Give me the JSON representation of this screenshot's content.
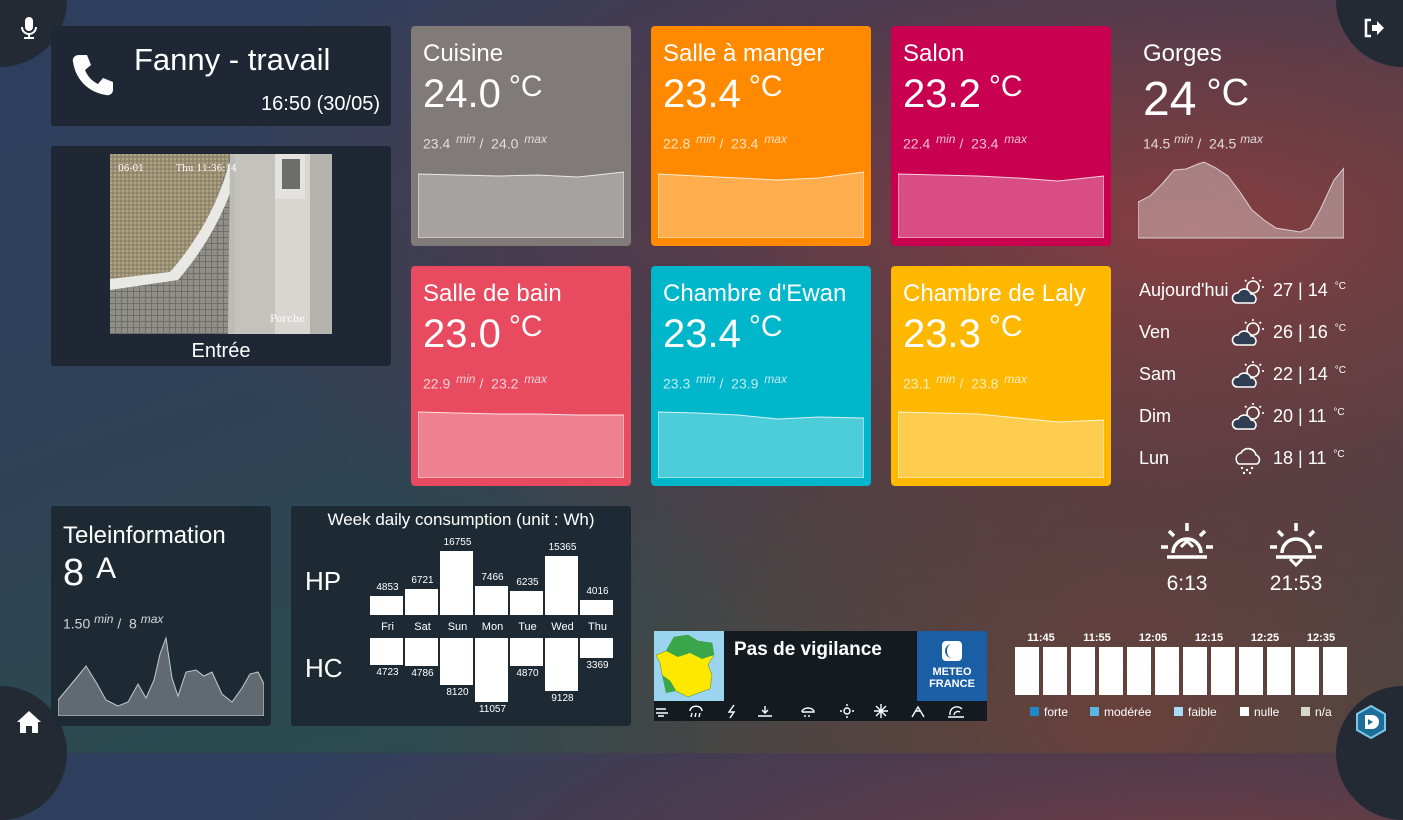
{
  "colors": {
    "cuisine": "#807a79",
    "salle_a_manger": "#ff8a00",
    "salon": "#c8004f",
    "salle_de_bain": "#e84a5f",
    "chambre_ewan": "#00b6cb",
    "chambre_laly": "#ffb800"
  },
  "corners": {
    "tl": "microphone-icon",
    "tr": "sign-out-icon",
    "bl": "home-icon",
    "br": "logo-icon"
  },
  "phone": {
    "name": "Fanny - travail",
    "time": "16:50 (30/05)"
  },
  "camera": {
    "label": "Entrée",
    "overlay_time": "Thu 11:36:14",
    "overlay_date": "06-01",
    "overlay_name": "Porche"
  },
  "rooms": [
    {
      "name": "Cuisine",
      "value": "24.0",
      "unit": "°C",
      "min": "23.4",
      "max": "24.0",
      "min_label": "min",
      "max_label": "max"
    },
    {
      "name": "Salle à manger",
      "value": "23.4",
      "unit": "°C",
      "min": "22.8",
      "max": "23.4",
      "min_label": "min",
      "max_label": "max"
    },
    {
      "name": "Salon",
      "value": "23.2",
      "unit": "°C",
      "min": "22.4",
      "max": "23.4",
      "min_label": "min",
      "max_label": "max"
    },
    {
      "name": "Salle de bain",
      "value": "23.0",
      "unit": "°C",
      "min": "22.9",
      "max": "23.2",
      "min_label": "min",
      "max_label": "max"
    },
    {
      "name": "Chambre d'Ewan",
      "value": "23.4",
      "unit": "°C",
      "min": "23.3",
      "max": "23.9",
      "min_label": "min",
      "max_label": "max"
    },
    {
      "name": "Chambre de Laly",
      "value": "23.3",
      "unit": "°C",
      "min": "23.1",
      "max": "23.8",
      "min_label": "min",
      "max_label": "max"
    }
  ],
  "outdoor": {
    "name": "Gorges",
    "value": "24",
    "unit": "°C",
    "min": "14.5",
    "max": "24.5",
    "min_label": "min",
    "max_label": "max"
  },
  "forecast": [
    {
      "day": "Aujourd'hui",
      "icon": "partly-cloudy-icon",
      "max": "27",
      "min": "14",
      "unit": "°C"
    },
    {
      "day": "Ven",
      "icon": "partly-cloudy-icon",
      "max": "26",
      "min": "16",
      "unit": "°C"
    },
    {
      "day": "Sam",
      "icon": "partly-cloudy-icon",
      "max": "22",
      "min": "14",
      "unit": "°C"
    },
    {
      "day": "Dim",
      "icon": "partly-cloudy-icon",
      "max": "20",
      "min": "11",
      "unit": "°C"
    },
    {
      "day": "Lun",
      "icon": "rain-icon",
      "max": "18",
      "min": "11",
      "unit": "°C"
    }
  ],
  "sun": {
    "sunrise": "6:13",
    "sunset": "21:53"
  },
  "teleinfo": {
    "title": "Teleinformation",
    "value": "8",
    "unit": "A",
    "min": "1.50",
    "max": "8",
    "min_label": "min",
    "max_label": "max"
  },
  "consumption": {
    "title": "Week daily consumption (unit : Wh)",
    "hp_label": "HP",
    "hc_label": "HC",
    "days": [
      "Fri",
      "Sat",
      "Sun",
      "Mon",
      "Tue",
      "Wed",
      "Thu"
    ],
    "hp": [
      4853,
      6721,
      16755,
      7466,
      6235,
      15365,
      4016
    ],
    "hc": [
      4723,
      4786,
      8120,
      11057,
      4870,
      9128,
      3369
    ]
  },
  "vigilance": {
    "text": "Pas de vigilance",
    "brand_line1": "METEO",
    "brand_line2": "FRANCE",
    "legend": [
      {
        "label": "forte",
        "color": "#1e87c8"
      },
      {
        "label": "modérée",
        "color": "#5ab4e6"
      },
      {
        "label": "faible",
        "color": "#a8dcf5"
      },
      {
        "label": "nulle",
        "color": "#ffffff"
      },
      {
        "label": "n/a",
        "color": "#d8d8c8"
      }
    ]
  },
  "rain_timeline": {
    "times": [
      "11:45",
      "11:55",
      "12:05",
      "12:15",
      "12:25",
      "12:35"
    ]
  }
}
